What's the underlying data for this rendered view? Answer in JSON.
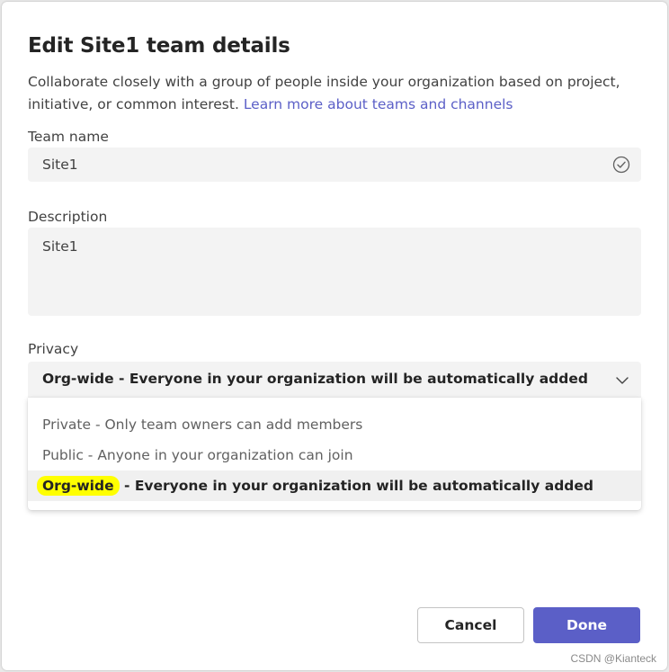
{
  "dialog": {
    "title": "Edit Site1 team details",
    "description": "Collaborate closely with a group of people inside your organization based on project, initiative, or common interest. ",
    "learn_more_link": "Learn more about teams and channels"
  },
  "team_name": {
    "label": "Team name",
    "value": "Site1"
  },
  "description_field": {
    "label": "Description",
    "value": "Site1"
  },
  "privacy": {
    "label": "Privacy",
    "selected": "Org-wide - Everyone in your organization will be automatically added",
    "options": [
      {
        "label": "Private - Only team owners can add members"
      },
      {
        "label": "Public - Anyone in your organization can join"
      },
      {
        "prefix": "Org-wide",
        "suffix": " - Everyone in your organization will be automatically added"
      }
    ]
  },
  "actions": {
    "cancel_label": "Cancel",
    "done_label": "Done"
  },
  "watermark": "CSDN @Kianteck",
  "colors": {
    "accent": "#5b5fc7",
    "highlight": "#ffff00",
    "field_bg": "#f3f3f3"
  },
  "icons": {
    "validated": "check-circle-icon",
    "dropdown": "chevron-down-icon"
  }
}
